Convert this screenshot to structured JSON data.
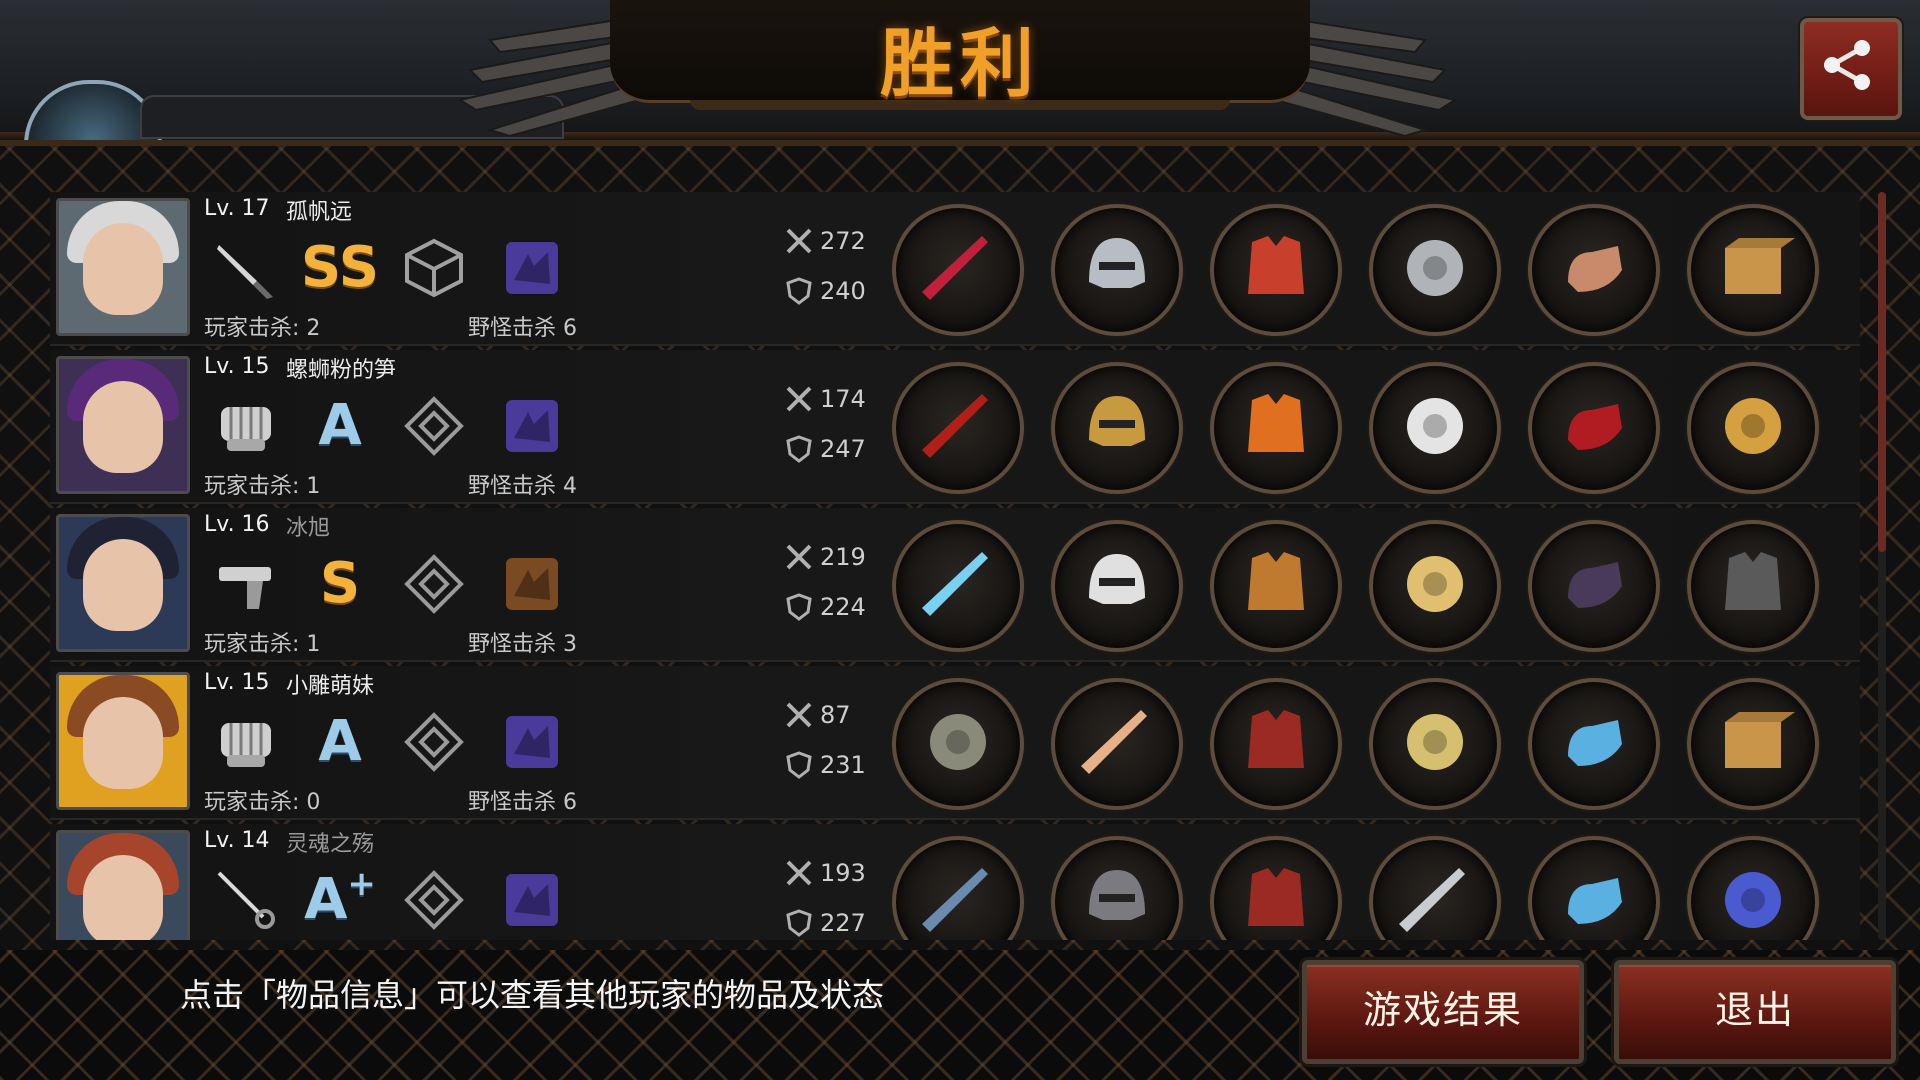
{
  "header": {
    "title": "胜利",
    "share_icon": "share-icon"
  },
  "players": [
    {
      "level": "Lv. 17",
      "name": "孤帆远",
      "name_dim": false,
      "weapon_icon": "knife-icon",
      "grade": "SS",
      "grade_sup": "",
      "grade_color": "gold",
      "player_kills": "玩家击杀: 2",
      "monster_kills": "野怪击杀 6",
      "attack": "272",
      "defense": "240",
      "avatar_hair": "#d8d8d8",
      "bg": "#5d6a72",
      "items": [
        "crimson-blade-icon",
        "silver-helmet-icon",
        "red-jacket-icon",
        "steel-disc-icon",
        "gauntlet-icon",
        "mystery-box-icon"
      ]
    },
    {
      "level": "Lv. 15",
      "name": "螺蛳粉的笋",
      "name_dim": false,
      "weapon_icon": "fist-icon",
      "grade": "A",
      "grade_sup": "",
      "grade_color": "blue",
      "player_kills": "玩家击杀: 1",
      "monster_kills": "野怪击杀 4",
      "attack": "174",
      "defense": "247",
      "avatar_hair": "#5a2a7a",
      "bg": "#3e3054",
      "items": [
        "winged-knuckles-icon",
        "golden-helmet-icon",
        "flame-armor-icon",
        "white-bracers-icon",
        "red-heels-icon",
        "jeweled-earrings-icon"
      ]
    },
    {
      "level": "Lv. 16",
      "name": "冰旭",
      "name_dim": true,
      "weapon_icon": "pistol-icon",
      "grade": "S",
      "grade_sup": "",
      "grade_color": "gold",
      "player_kills": "玩家击杀: 1",
      "monster_kills": "野怪击杀 3",
      "attack": "219",
      "defense": "224",
      "avatar_hair": "#1e2233",
      "bg": "#2c3a58",
      "items": [
        "plasma-rifle-icon",
        "motocross-helmet-icon",
        "bronze-armor-icon",
        "golden-shield-icon",
        "dark-gloves-icon",
        "tactical-vest-icon"
      ]
    },
    {
      "level": "Lv. 15",
      "name": "小雕萌妹",
      "name_dim": false,
      "weapon_icon": "fist-icon",
      "grade": "A",
      "grade_sup": "",
      "grade_color": "blue",
      "player_kills": "玩家击杀: 0",
      "monster_kills": "野怪击杀 6",
      "attack": "87",
      "defense": "231",
      "avatar_hair": "#8a4a24",
      "bg": "#e0a020",
      "items": [
        "brass-knuckles-icon",
        "winged-tiara-icon",
        "red-coat-icon",
        "gem-ring-icon",
        "sneakers-icon",
        "mystery-box-icon"
      ]
    },
    {
      "level": "Lv. 14",
      "name": "灵魂之殇",
      "name_dim": true,
      "weapon_icon": "rapier-icon",
      "grade": "A",
      "grade_sup": "+",
      "grade_color": "blue",
      "player_kills": "",
      "monster_kills": "",
      "attack": "193",
      "defense": "227",
      "avatar_hair": "#a6442c",
      "bg": "#3a4a5c",
      "items": [
        "trident-icon",
        "knight-helmet-icon",
        "red-coat-icon",
        "blade-bracer-icon",
        "sneakers-icon",
        "galaxy-orb-icon"
      ]
    }
  ],
  "footer": {
    "hint": "点击「物品信息」可以查看其他玩家的物品及状态",
    "result_button": "游戏结果",
    "exit_button": "退出"
  },
  "colors": {
    "accent": "#f0a029",
    "button": "#7a2418"
  }
}
